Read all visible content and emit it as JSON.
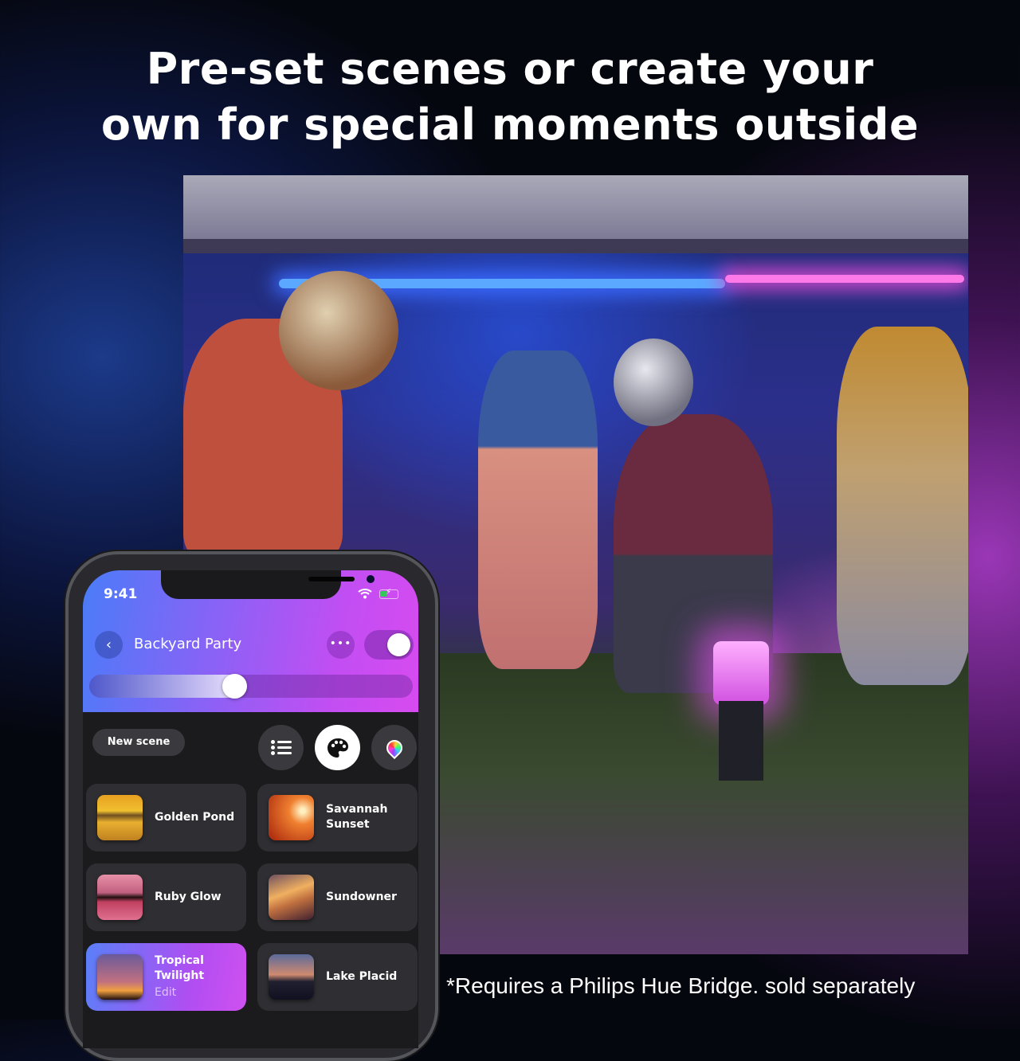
{
  "headline": {
    "line1": "Pre-set scenes or create your",
    "line2": "own for special moments outside"
  },
  "disclaimer": "*Requires a Philips Hue Bridge. sold separately",
  "phone": {
    "status_bar": {
      "time": "9:41",
      "wifi_icon": "wifi-icon",
      "battery_icon": "battery-charging-icon"
    },
    "header": {
      "back_icon": "‹",
      "title": "Backyard Party",
      "more_icon": "•••",
      "power_toggle_on": true,
      "brightness_percent": 45,
      "colors": {
        "gradient_start": "#4a7cf8",
        "gradient_end": "#d74bf0"
      }
    },
    "toolbar": {
      "new_scene_label": "New scene",
      "view_buttons": [
        {
          "name": "list-view",
          "icon": "list-icon",
          "active": false
        },
        {
          "name": "palette-view",
          "icon": "palette-icon",
          "active": true
        },
        {
          "name": "color-picker-view",
          "icon": "color-pin-icon",
          "active": false
        }
      ]
    },
    "scenes": [
      {
        "name": "Golden Pond",
        "active": false
      },
      {
        "name": "Savannah Sunset",
        "line1": "Savannah",
        "line2": "Sunset",
        "active": false
      },
      {
        "name": "Ruby Glow",
        "active": false
      },
      {
        "name": "Sundowner",
        "active": false
      },
      {
        "name": "Tropical Twilight",
        "line1": "Tropical",
        "line2": "Twilight",
        "edit_label": "Edit",
        "active": true
      },
      {
        "name": "Lake Placid",
        "active": false
      }
    ]
  }
}
